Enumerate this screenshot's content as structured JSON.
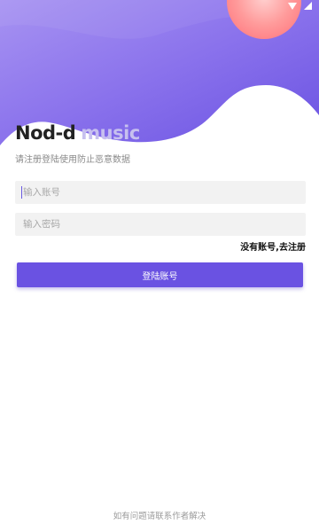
{
  "app": {
    "title_part1": "Nod-d",
    "title_part2": "music",
    "subtitle": "请注册登陆使用防止恶意数据"
  },
  "form": {
    "account_placeholder": "输入账号",
    "password_placeholder": "输入密码",
    "register_link": "没有账号,去注册",
    "login_button": "登陆账号"
  },
  "footer": {
    "text": "如有问题请联系作者解决"
  },
  "status_bar": {
    "icons": [
      "wifi-icon",
      "signal-icon"
    ]
  },
  "colors": {
    "primary": "#6a52e2",
    "header_gradient_start": "#a48ef0",
    "header_gradient_end": "#6a52e2",
    "accent_circle": "#ff8f8f"
  }
}
